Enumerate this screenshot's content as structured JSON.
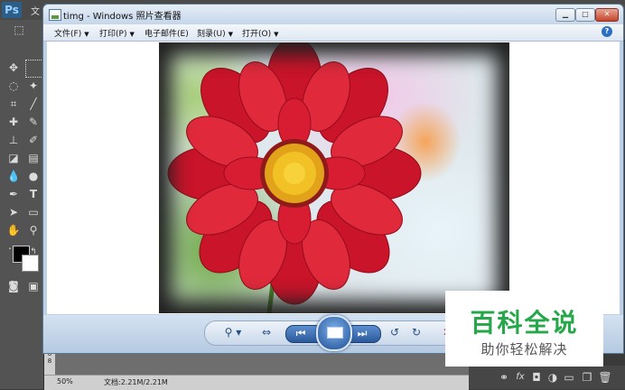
{
  "photoshop": {
    "logo": "Ps",
    "menu_peek": "文",
    "status_zoom": "50%",
    "status_docsize": "文档:2.21M/2.21M",
    "ruler_marks": "8\n0\n8"
  },
  "viewer": {
    "title": "timg - Windows 照片查看器",
    "menu": {
      "file": "文件(F)",
      "print": "打印(P)",
      "email": "电子邮件(E)",
      "burn": "刻录(U)",
      "open": "打开(O)"
    },
    "help": "?",
    "caption": {
      "min": "▁",
      "max": "□",
      "close": "✕"
    },
    "controls": {
      "zoom": "⚲ ▾",
      "fit": "⇔",
      "prev": "⏮",
      "next": "⏭",
      "rotate_ccw": "↺",
      "rotate_cw": "↻",
      "delete": "✕"
    }
  },
  "watermark": {
    "title": "百科全说",
    "subtitle": "助你轻松解决"
  }
}
